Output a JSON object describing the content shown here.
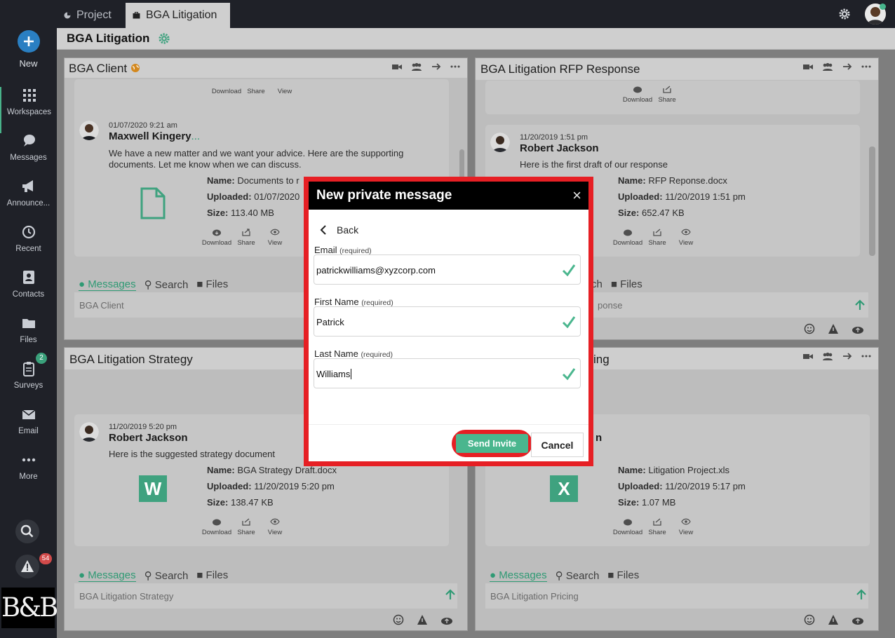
{
  "sidebar": {
    "new_label": "New",
    "items": [
      {
        "label": "Workspaces",
        "icon": "grid-icon"
      },
      {
        "label": "Messages",
        "icon": "chat-bubble-icon"
      },
      {
        "label": "Announce...",
        "icon": "megaphone-icon"
      },
      {
        "label": "Recent",
        "icon": "history-icon"
      },
      {
        "label": "Contacts",
        "icon": "contacts-icon"
      },
      {
        "label": "Files",
        "icon": "folder-icon"
      },
      {
        "label": "Surveys",
        "icon": "clipboard-icon",
        "badge": "2"
      },
      {
        "label": "Email",
        "icon": "envelope-icon"
      },
      {
        "label": "More",
        "icon": "more-dots-icon"
      }
    ],
    "alerts_badge": "54",
    "logo_text": "B&B"
  },
  "tabs": [
    {
      "label": "Project"
    },
    {
      "label": "BGA Litigation"
    }
  ],
  "page_title": "BGA Litigation",
  "panels": [
    {
      "title": "BGA Client",
      "messages": [
        {
          "date": "01/07/2020 9:21 am",
          "author": "Maxwell Kingery",
          "author_suffix": "...",
          "text": "We have a new matter and we want your advice. Here are the supporting documents. Let me know when we can discuss.",
          "file_name": "Documents to r",
          "file_uploaded": "01/07/2020",
          "file_size": "113.40 MB"
        }
      ],
      "composer_placeholder": "BGA Client"
    },
    {
      "title": "BGA Litigation RFP Response",
      "messages": [
        {
          "date": "11/20/2019 1:51 pm",
          "author": "Robert Jackson",
          "text": "Here is the first draft of our response",
          "file_name": "RFP Reponse.docx",
          "file_uploaded": "11/20/2019 1:51 pm",
          "file_size": "652.47 KB"
        }
      ],
      "composer_placeholder": "ponse"
    },
    {
      "title": "BGA Litigation Strategy",
      "messages": [
        {
          "date": "11/20/2019 5:20 pm",
          "author": "Robert Jackson",
          "text": "Here is the suggested strategy document",
          "file_name": "BGA Strategy Draft.docx",
          "file_uploaded": "11/20/2019 5:20 pm",
          "file_size": "138.47 KB",
          "file_icon": "W"
        }
      ],
      "composer_placeholder": "BGA Litigation Strategy"
    },
    {
      "title": "ing",
      "messages": [
        {
          "author": "n",
          "file_name": "Litigation Project.xls",
          "file_uploaded": "11/20/2019 5:17 pm",
          "file_size": "1.07 MB",
          "file_icon": "X"
        }
      ],
      "composer_placeholder": "BGA Litigation Pricing"
    }
  ],
  "labels": {
    "download": "Download",
    "share": "Share",
    "view": "View",
    "name": "Name:",
    "uploaded": "Uploaded:",
    "size": "Size:",
    "tab_messages": "Messages",
    "tab_search": "Search",
    "tab_files": "Files",
    "tab_search_partial": "rch"
  },
  "modal": {
    "title": "New private message",
    "close": "×",
    "back_label": "Back",
    "email_label": "Email",
    "first_name_label": "First Name",
    "last_name_label": "Last Name",
    "required_label": "(required)",
    "email_value": "patrickwilliams@xyzcorp.com",
    "first_name_value": "Patrick",
    "last_name_value": "Williams",
    "send_label": "Send Invite",
    "cancel_label": "Cancel"
  },
  "colors": {
    "accent_green": "#4ab68e",
    "highlight_red": "#e61f24",
    "new_button_blue": "#2a7fc2"
  }
}
